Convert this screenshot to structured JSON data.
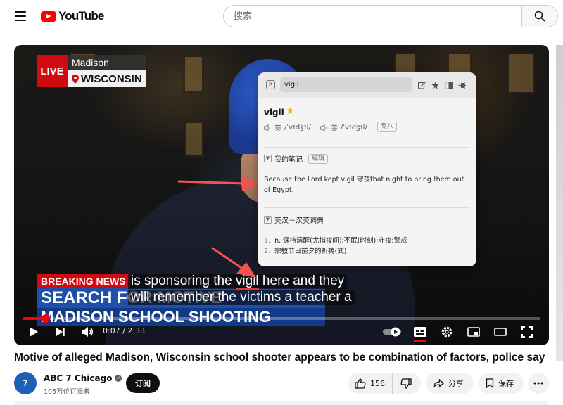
{
  "header": {
    "logo_text": "YouTube",
    "search_placeholder": "搜索"
  },
  "video": {
    "live_label": "LIVE",
    "location_city": "Madison",
    "location_state": "WISCONSIN",
    "breaking_label": "BREAKING NEWS",
    "headline_line1": "SEARCH FOR MOTIVE",
    "headline_line2": "MADISON SCHOOL SHOOTING",
    "caption_line1_pre": "is sponsoring the ",
    "caption_highlight": "vigil",
    "caption_line1_post": " here and they",
    "caption_line2": "will remember the victims a teacher a",
    "time_display": "0:07 / 2:33",
    "progress": 0.045
  },
  "dictionary": {
    "query": "vigil",
    "word": "vigil",
    "phonetic_uk_label": "英",
    "phonetic_uk": "/ˈvɪdʒɪl/",
    "phonetic_us_label": "美",
    "phonetic_us": "/ˈvɪdʒɪl/",
    "level_tag": "专八",
    "notes_title": "我的笔记",
    "edit_label": "编辑",
    "note_text": "Because the Lord kept vigil 守夜that night to bring them out of Egypt.",
    "dict_title": "英汉－汉英词典",
    "definitions": [
      {
        "num": "1.",
        "text": "n. 保持清醒(尤指夜间);不眠(时刻);守夜;警戒"
      },
      {
        "num": "2.",
        "text": "宗教节日前夕的祈祷(式)"
      }
    ]
  },
  "meta": {
    "title": "Motive of alleged Madison, Wisconsin school shooter appears to be combination of factors, police say",
    "channel_name": "ABC 7 Chicago",
    "avatar_text": "7",
    "subscribers": "105万位订阅者",
    "subscribe_label": "订阅",
    "like_count": "156",
    "share_label": "分享",
    "save_label": "保存"
  }
}
